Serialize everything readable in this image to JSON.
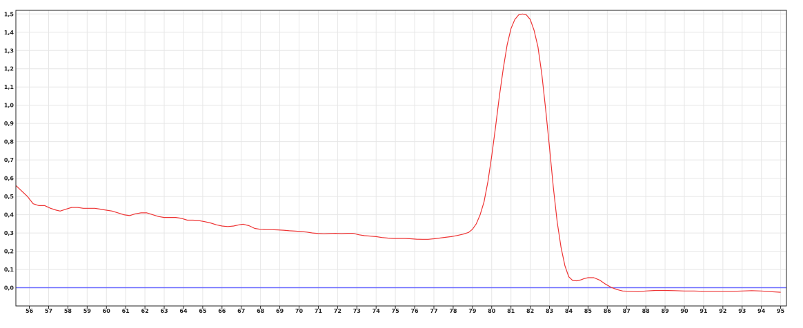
{
  "chart_data": {
    "type": "line",
    "title": "",
    "xlabel": "",
    "ylabel": "",
    "xlim": [
      55.3,
      95.3
    ],
    "ylim": [
      -0.1,
      1.52
    ],
    "grid": true,
    "x_ticks": [
      56,
      57,
      58,
      59,
      60,
      61,
      62,
      63,
      64,
      65,
      66,
      67,
      68,
      69,
      70,
      71,
      72,
      73,
      74,
      75,
      76,
      77,
      78,
      79,
      80,
      81,
      82,
      83,
      84,
      85,
      86,
      87,
      88,
      89,
      90,
      91,
      92,
      93,
      94,
      95
    ],
    "x_tick_labels": [
      "56",
      "57",
      "58",
      "59",
      "60",
      "61",
      "62",
      "63",
      "64",
      "65",
      "66",
      "67",
      "68",
      "69",
      "70",
      "71",
      "72",
      "73",
      "74",
      "75",
      "76",
      "77",
      "78",
      "79",
      "80",
      "81",
      "82",
      "83",
      "84",
      "85",
      "86",
      "87",
      "88",
      "89",
      "90",
      "91",
      "92",
      "93",
      "94",
      "95"
    ],
    "y_ticks": [
      0.0,
      0.1,
      0.2,
      0.3,
      0.4,
      0.5,
      0.6,
      0.7,
      0.8,
      0.9,
      1.0,
      1.1,
      1.2,
      1.3,
      1.4,
      1.5
    ],
    "y_tick_labels": [
      "0,0",
      "0,1",
      "0,2",
      "0,3",
      "0,4",
      "0,5",
      "0,6",
      "0,7",
      "0,8",
      "0,9",
      "1,0",
      "1,1",
      "1,2",
      "1,3",
      "1,4",
      "1,5"
    ],
    "baseline": {
      "y": 0.0,
      "color": "#6b6bff"
    },
    "series": [
      {
        "color": "#ee3333",
        "points": [
          [
            55.3,
            0.56
          ],
          [
            55.6,
            0.53
          ],
          [
            55.9,
            0.5
          ],
          [
            56.2,
            0.46
          ],
          [
            56.5,
            0.45
          ],
          [
            56.8,
            0.45
          ],
          [
            57.1,
            0.435
          ],
          [
            57.4,
            0.425
          ],
          [
            57.6,
            0.42
          ],
          [
            57.9,
            0.43
          ],
          [
            58.2,
            0.44
          ],
          [
            58.5,
            0.44
          ],
          [
            58.8,
            0.435
          ],
          [
            59.1,
            0.435
          ],
          [
            59.4,
            0.435
          ],
          [
            59.7,
            0.43
          ],
          [
            60.0,
            0.425
          ],
          [
            60.3,
            0.42
          ],
          [
            60.6,
            0.41
          ],
          [
            60.9,
            0.4
          ],
          [
            61.2,
            0.395
          ],
          [
            61.5,
            0.405
          ],
          [
            61.8,
            0.41
          ],
          [
            62.1,
            0.41
          ],
          [
            62.4,
            0.4
          ],
          [
            62.7,
            0.39
          ],
          [
            63.0,
            0.385
          ],
          [
            63.3,
            0.385
          ],
          [
            63.6,
            0.385
          ],
          [
            63.9,
            0.38
          ],
          [
            64.2,
            0.37
          ],
          [
            64.5,
            0.37
          ],
          [
            64.8,
            0.368
          ],
          [
            65.1,
            0.362
          ],
          [
            65.4,
            0.355
          ],
          [
            65.7,
            0.345
          ],
          [
            66.0,
            0.338
          ],
          [
            66.3,
            0.335
          ],
          [
            66.6,
            0.338
          ],
          [
            66.9,
            0.345
          ],
          [
            67.1,
            0.348
          ],
          [
            67.4,
            0.34
          ],
          [
            67.7,
            0.325
          ],
          [
            68.0,
            0.32
          ],
          [
            68.3,
            0.318
          ],
          [
            68.6,
            0.318
          ],
          [
            68.9,
            0.317
          ],
          [
            69.2,
            0.315
          ],
          [
            69.5,
            0.312
          ],
          [
            69.8,
            0.31
          ],
          [
            70.1,
            0.308
          ],
          [
            70.4,
            0.305
          ],
          [
            70.7,
            0.3
          ],
          [
            71.0,
            0.297
          ],
          [
            71.3,
            0.295
          ],
          [
            71.6,
            0.297
          ],
          [
            71.9,
            0.298
          ],
          [
            72.2,
            0.296
          ],
          [
            72.5,
            0.298
          ],
          [
            72.8,
            0.298
          ],
          [
            73.1,
            0.29
          ],
          [
            73.4,
            0.285
          ],
          [
            73.7,
            0.283
          ],
          [
            74.0,
            0.28
          ],
          [
            74.3,
            0.275
          ],
          [
            74.6,
            0.272
          ],
          [
            74.9,
            0.27
          ],
          [
            75.2,
            0.27
          ],
          [
            75.5,
            0.27
          ],
          [
            75.8,
            0.268
          ],
          [
            76.1,
            0.266
          ],
          [
            76.4,
            0.265
          ],
          [
            76.7,
            0.265
          ],
          [
            77.0,
            0.268
          ],
          [
            77.3,
            0.272
          ],
          [
            77.6,
            0.276
          ],
          [
            77.9,
            0.28
          ],
          [
            78.2,
            0.286
          ],
          [
            78.5,
            0.293
          ],
          [
            78.8,
            0.303
          ],
          [
            79.0,
            0.32
          ],
          [
            79.2,
            0.35
          ],
          [
            79.4,
            0.4
          ],
          [
            79.6,
            0.47
          ],
          [
            79.8,
            0.58
          ],
          [
            80.0,
            0.72
          ],
          [
            80.2,
            0.88
          ],
          [
            80.4,
            1.05
          ],
          [
            80.6,
            1.2
          ],
          [
            80.8,
            1.33
          ],
          [
            81.0,
            1.42
          ],
          [
            81.2,
            1.47
          ],
          [
            81.4,
            1.495
          ],
          [
            81.6,
            1.5
          ],
          [
            81.8,
            1.495
          ],
          [
            82.0,
            1.47
          ],
          [
            82.2,
            1.41
          ],
          [
            82.4,
            1.32
          ],
          [
            82.6,
            1.17
          ],
          [
            82.8,
            0.98
          ],
          [
            83.0,
            0.77
          ],
          [
            83.2,
            0.55
          ],
          [
            83.4,
            0.36
          ],
          [
            83.6,
            0.22
          ],
          [
            83.8,
            0.12
          ],
          [
            84.0,
            0.06
          ],
          [
            84.2,
            0.04
          ],
          [
            84.4,
            0.038
          ],
          [
            84.6,
            0.042
          ],
          [
            84.8,
            0.05
          ],
          [
            85.0,
            0.055
          ],
          [
            85.3,
            0.055
          ],
          [
            85.6,
            0.042
          ],
          [
            85.9,
            0.02
          ],
          [
            86.2,
            0.002
          ],
          [
            86.5,
            -0.01
          ],
          [
            86.8,
            -0.018
          ],
          [
            87.2,
            -0.02
          ],
          [
            87.6,
            -0.022
          ],
          [
            88.0,
            -0.018
          ],
          [
            88.5,
            -0.015
          ],
          [
            89.0,
            -0.015
          ],
          [
            89.5,
            -0.016
          ],
          [
            90.0,
            -0.018
          ],
          [
            90.5,
            -0.018
          ],
          [
            91.0,
            -0.02
          ],
          [
            91.5,
            -0.02
          ],
          [
            92.0,
            -0.02
          ],
          [
            92.5,
            -0.02
          ],
          [
            93.0,
            -0.018
          ],
          [
            93.5,
            -0.016
          ],
          [
            94.0,
            -0.018
          ],
          [
            94.5,
            -0.022
          ],
          [
            95.0,
            -0.025
          ]
        ]
      }
    ]
  }
}
